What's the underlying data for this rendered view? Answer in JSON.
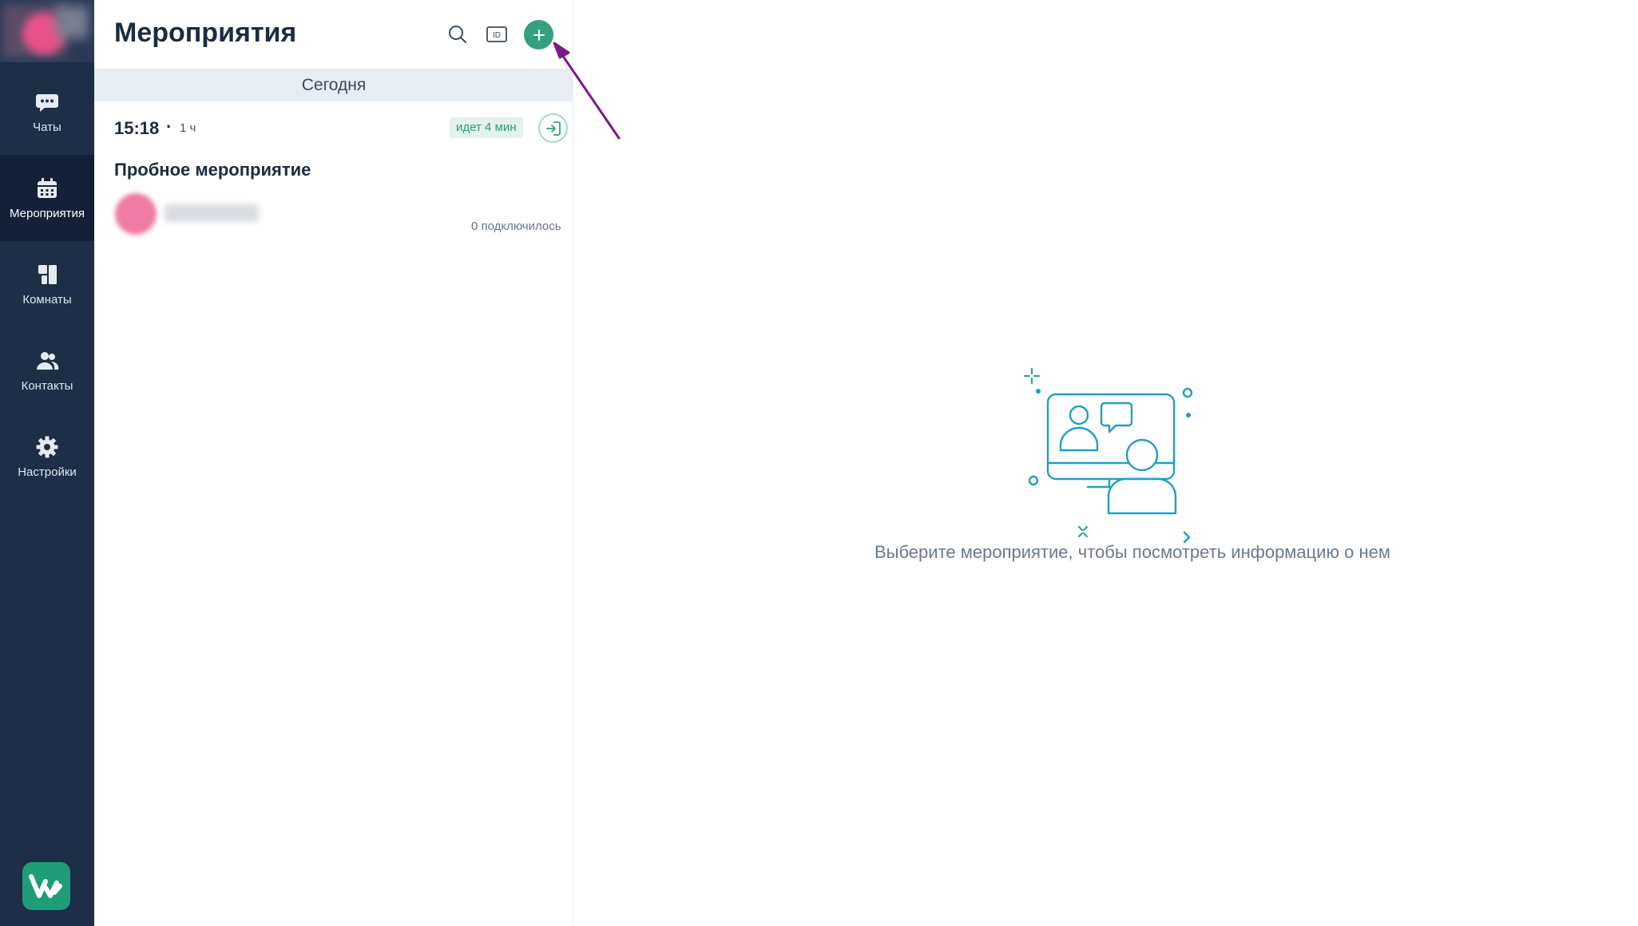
{
  "sidebar": {
    "items": [
      {
        "label": "Чаты",
        "icon": "chat-icon"
      },
      {
        "label": "Мероприятия",
        "icon": "calendar-icon"
      },
      {
        "label": "Комнаты",
        "icon": "rooms-icon"
      },
      {
        "label": "Контакты",
        "icon": "contacts-icon"
      },
      {
        "label": "Настройки",
        "icon": "gear-icon"
      }
    ],
    "active_item": "Мероприятия"
  },
  "header": {
    "title": "Мероприятия",
    "search_icon": "search-icon",
    "id_label": "ID",
    "add_icon": "plus-icon"
  },
  "events": {
    "day_label": "Сегодня",
    "items": [
      {
        "time": "15:18",
        "separator": "·",
        "duration": "1 ч",
        "status": "идет 4 мин",
        "title": "Пробное мероприятие",
        "connected": "0 подключилось"
      }
    ]
  },
  "empty_state": {
    "text": "Выберите мероприятие, чтобы посмотреть информацию о нем"
  },
  "colors": {
    "sidebar_bg": "#1e2e47",
    "accent": "#34a07f",
    "annotation_arrow": "#7a1a86",
    "illustration": "#1fa0c4"
  }
}
